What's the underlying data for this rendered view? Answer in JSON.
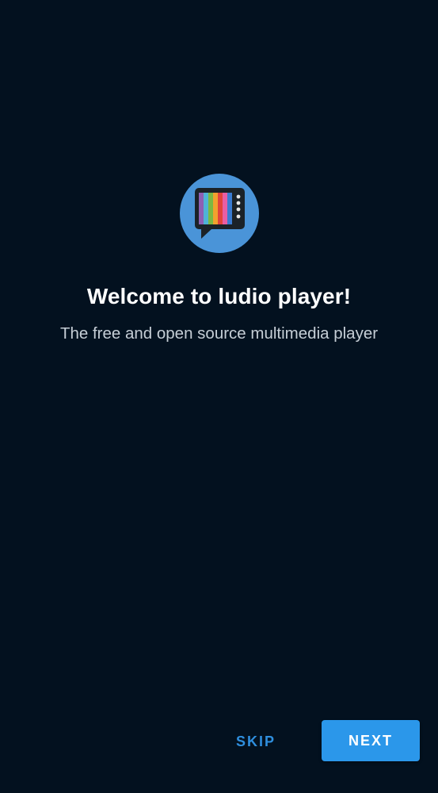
{
  "welcome": {
    "logo_icon": "tv-speech-bubble-icon",
    "title": "Welcome to ludio player!",
    "subtitle": "The free and open source multimedia player"
  },
  "actions": {
    "skip_label": "SKIP",
    "next_label": "NEXT"
  },
  "colors": {
    "background": "#03111f",
    "accent": "#2b97ea",
    "logo_circle": "#4a94d8"
  }
}
